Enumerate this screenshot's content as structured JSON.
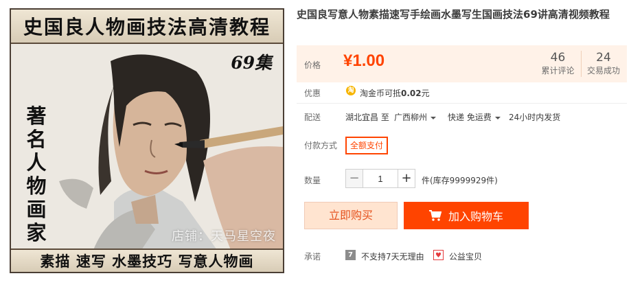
{
  "product_image": {
    "banner_top": "史国良人物画技法高清教程",
    "episodes": "69集",
    "vertical_label": "著名人物画家",
    "banner_bottom": "素描 速写 水墨技巧 写意人物画",
    "watermark": "店铺：天马星空夜"
  },
  "product": {
    "title": "史国良写意人物素描速写手绘画水墨写生国画技法69讲高清视频教程"
  },
  "price": {
    "label": "价格",
    "value": "¥1.00",
    "reviews_count": "46",
    "reviews_label": "累计评论",
    "sales_count": "24",
    "sales_label": "交易成功"
  },
  "promo": {
    "label": "优惠",
    "coin_icon": "淘",
    "text_prefix": "淘金币可抵",
    "amount": "0.02",
    "unit": "元"
  },
  "shipping": {
    "label": "配送",
    "origin": "湖北宜昌 至",
    "destination": "广西柳州",
    "method": "快递 免运费",
    "dispatch": "24小时内发货"
  },
  "payment": {
    "label": "付款方式",
    "option": "全额支付"
  },
  "quantity": {
    "label": "数量",
    "minus": "−",
    "value": "1",
    "plus": "+",
    "unit_stock": "件(库存9999929件)"
  },
  "actions": {
    "buy_now": "立即购买",
    "add_to_cart": "加入购物车"
  },
  "promise": {
    "label": "承诺",
    "no_return_icon": "7",
    "no_return": "不支持7天无理由",
    "charity_icon": "♥",
    "charity": "公益宝贝"
  },
  "colors": {
    "accent": "#ff4400",
    "price_bg": "#fff2e8",
    "buy_now_bg": "#ffe4d0"
  }
}
